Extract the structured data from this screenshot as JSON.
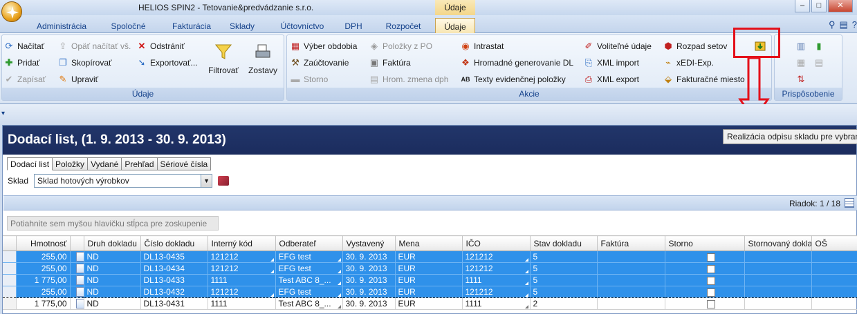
{
  "window": {
    "title": "HELIOS SPIN2 - Tetovanie&predvádzanie s.r.o.",
    "context_tab_title": "Údaje",
    "minimize": "–",
    "maximize": "□",
    "close": "✕"
  },
  "ribbon_tabs": [
    "Administrácia",
    "Spoločné",
    "Fakturácia",
    "Sklady",
    "Účtovníctvo",
    "DPH",
    "Rozpočet",
    "Údaje"
  ],
  "ribbon": {
    "udaje_group": {
      "label": "Údaje",
      "nacitat": "Načítať",
      "opat_nacitat": "Opäť načítať vš.",
      "odstranit": "Odstrániť",
      "pridat": "Pridať",
      "skopirovat": "Skopírovať",
      "exportovat": "Exportovať...",
      "zapisat": "Zapísať",
      "upravit": "Upraviť",
      "filtrovat": "Filtrovať",
      "zostavy": "Zostavy"
    },
    "akcie_group": {
      "label": "Akcie",
      "vyber_obdobia": "Výber obdobia",
      "zauctovanie": "Zaúčtovanie",
      "storno": "Storno",
      "polozky_z_po": "Položky z PO",
      "faktura": "Faktúra",
      "hrom_zmena_dph": "Hrom. zmena dph",
      "intrastat": "Intrastat",
      "hromadne_generovanie": "Hromadné generovanie DL",
      "texty_evidencnej": "Texty evidenčnej položky",
      "volitelne_udaje": "Voliteľné údaje",
      "xml_import": "XML import",
      "xml_export": "XML export",
      "rozpad_setov": "Rozpad setov",
      "xedi_exp": "xEDI-Exp.",
      "fakturacne_miesto": "Fakturačné miesto"
    },
    "prisposobenie_group": {
      "label": "Prispôsobenie"
    }
  },
  "form": {
    "title": "Dodací list,  (1. 9. 2013 - 30. 9. 2013)",
    "tooltip": "Realizácia odpisu skladu pre vybrané",
    "subtabs": [
      "Dodací list",
      "Položky",
      "Vydané",
      "Prehľad",
      "Sériové čísla"
    ],
    "sklad_label": "Sklad",
    "sklad_value": "Sklad hotových výrobkov",
    "riadok": "Riadok: 1 / 18",
    "group_hint": "Potiahnite sem myšou hlavičku stĺpca pre zoskupenie"
  },
  "grid": {
    "columns": [
      "Hmotnosť",
      "Druh dokladu",
      "Číslo dokladu",
      "Interný kód",
      "Odberateľ",
      "Vystavený",
      "Mena",
      "IČO",
      "Stav dokladu",
      "Faktúra",
      "Storno",
      "Stornovaný doklad",
      "OŠ"
    ],
    "rows": [
      {
        "hmotnost": "255,00",
        "druh": "ND",
        "cislo": "DL13-0435",
        "kod": "121212",
        "odberatel": "EFG test",
        "vystaveny": "30. 9. 2013",
        "mena": "EUR",
        "ico": "121212",
        "stav": "5",
        "selected": true
      },
      {
        "hmotnost": "255,00",
        "druh": "ND",
        "cislo": "DL13-0434",
        "kod": "121212",
        "odberatel": "EFG test",
        "vystaveny": "30. 9. 2013",
        "mena": "EUR",
        "ico": "121212",
        "stav": "5",
        "selected": true
      },
      {
        "hmotnost": "1 775,00",
        "druh": "ND",
        "cislo": "DL13-0433",
        "kod": "1111",
        "odberatel": "Test ABC 8_...",
        "vystaveny": "30. 9. 2013",
        "mena": "EUR",
        "ico": "1111",
        "stav": "5",
        "selected": true
      },
      {
        "hmotnost": "255,00",
        "druh": "ND",
        "cislo": "DL13-0432",
        "kod": "121212",
        "odberatel": "EFG test",
        "vystaveny": "30. 9. 2013",
        "mena": "EUR",
        "ico": "121212",
        "stav": "5",
        "selected": true
      },
      {
        "hmotnost": "1 775,00",
        "druh": "ND",
        "cislo": "DL13-0431",
        "kod": "1111",
        "odberatel": "Test ABC 8_...",
        "vystaveny": "30. 9. 2013",
        "mena": "EUR",
        "ico": "1111",
        "stav": "2",
        "selected": false
      }
    ]
  }
}
